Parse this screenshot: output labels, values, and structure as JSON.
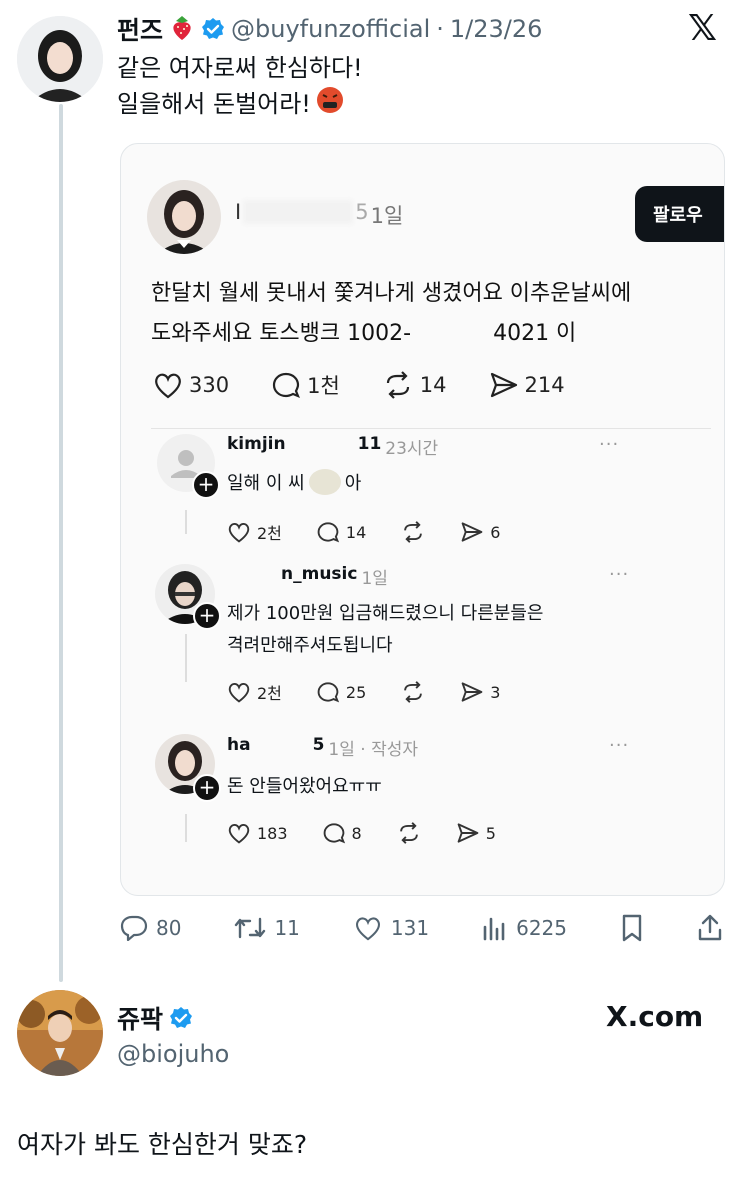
{
  "main_tweet": {
    "author_name": "펀즈",
    "handle": "@buyfunzofficial",
    "separator": "·",
    "date": "1/23/26",
    "text_line1": "같은 여자로써 한심하다!",
    "text_line2": "일을해서 돈벌어라!",
    "x_logo": "𝕏",
    "stats": {
      "replies": "80",
      "retweets": "11",
      "likes": "131",
      "views": "6225"
    }
  },
  "embedded": {
    "post_time": "1일",
    "follow_label": "팔로우",
    "post_line1": "한달치 월세 못내서 쫓겨나게 생겼어요 이추운날씨에",
    "post_line2_a": "도와주세요 토스뱅크 1002-",
    "post_line2_b": "4021 이",
    "stats": {
      "likes": "330",
      "comments": "1천",
      "reposts": "14",
      "shares": "214"
    },
    "replies": [
      {
        "user": "kimjin",
        "user_tail": "11",
        "time": "23시간",
        "text_a": "일해 이 씨",
        "text_b": "아",
        "likes": "2천",
        "comments": "14",
        "shares": "6"
      },
      {
        "user": "n_music",
        "time": "1일",
        "text_line1": "제가 100만원 입금해드렸으니 다른분들은",
        "text_line2": "격려만해주셔도됩니다",
        "likes": "2천",
        "comments": "25",
        "shares": "3"
      },
      {
        "user": "ha",
        "user_tail": "5",
        "time": "1일 · 작성자",
        "text": "돈 안들어왔어요ㅠㅠ",
        "likes": "183",
        "comments": "8",
        "shares": "5"
      }
    ]
  },
  "quote_author": {
    "name": "쥬팍",
    "handle": "@biojuho",
    "site": "X.com",
    "text": "여자가 봐도 한심한거 맞죠?"
  },
  "colors": {
    "verified": "#1d9bf0",
    "text": "#0f1419",
    "muted": "#536471"
  }
}
